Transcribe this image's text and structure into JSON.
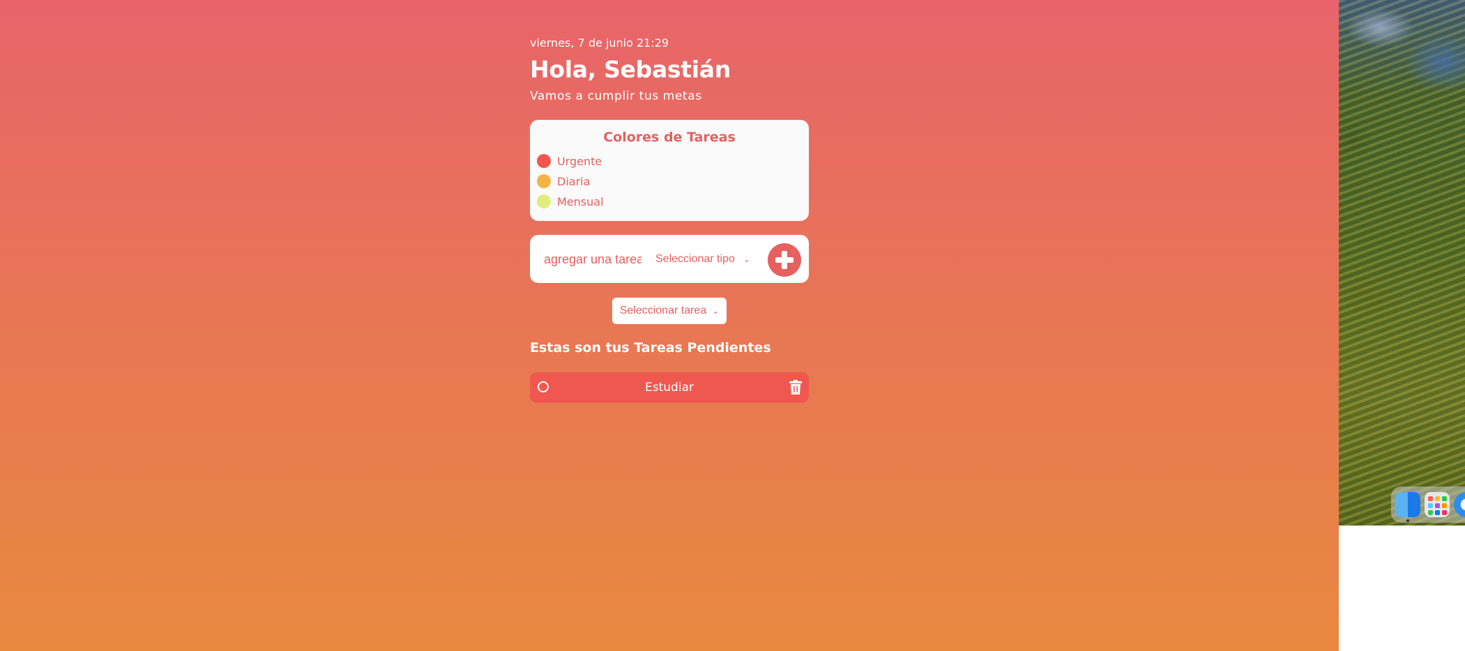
{
  "header": {
    "datetime": "viernes, 7 de junio 21:29",
    "greeting": "Hola, Sebastián",
    "subtitle": "Vamos a cumplir tus metas"
  },
  "legend": {
    "title": "Colores de Tareas",
    "items": [
      {
        "label": "Urgente",
        "color": "#f0574f"
      },
      {
        "label": "Diaria",
        "color": "#f5b345"
      },
      {
        "label": "Mensual",
        "color": "#dfee7a"
      }
    ]
  },
  "add_task": {
    "input_placeholder": "agregar una tarea",
    "type_select_value": "Seleccionar tipo",
    "add_icon": "plus-icon"
  },
  "filter": {
    "select_value": "Seleccionar tarea"
  },
  "pending": {
    "heading": "Estas son tus Tareas Pendientes",
    "tasks": [
      {
        "label": "Estudiar",
        "color": "#f0574f",
        "check_icon": "circle-outline-icon",
        "delete_icon": "trash-icon"
      }
    ]
  },
  "colors": {
    "gradient_top": "#e8646a",
    "gradient_bottom": "#e8893f",
    "accent": "#e6605f"
  }
}
